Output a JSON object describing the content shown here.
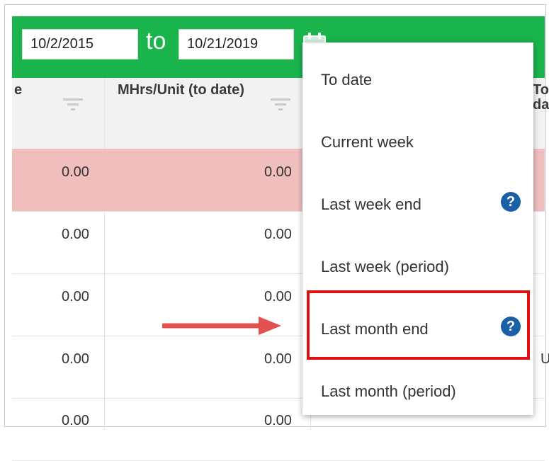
{
  "filter": {
    "start_date": "10/2/2015",
    "to_label": "to",
    "end_date": "10/21/2019"
  },
  "columns": [
    {
      "label": "e"
    },
    {
      "label": "MHrs/Unit (to date)"
    },
    {
      "label": "To da"
    }
  ],
  "rows": [
    {
      "c1": "0.00",
      "c2": "0.00",
      "highlighted": true
    },
    {
      "c1": "0.00",
      "c2": "0.00"
    },
    {
      "c1": "0.00",
      "c2": "0.00"
    },
    {
      "c1": "0.00",
      "c2": "0.00",
      "c3": "U"
    },
    {
      "c1": "0.00",
      "c2": "0.00"
    }
  ],
  "menu": {
    "items": [
      {
        "label": "To date"
      },
      {
        "label": "Current week"
      },
      {
        "label": "Last week end",
        "help_icon": "question-circle-icon"
      },
      {
        "label": "Last week (period)"
      },
      {
        "label": "Last month end",
        "help_icon": "question-circle-icon",
        "highlighted": true
      },
      {
        "label": "Last month (period)"
      }
    ],
    "help_glyph": "?"
  },
  "colors": {
    "header_green": "#1ab44d",
    "highlight_row": "#f1bebe",
    "annotation_red": "#e01010",
    "help_blue": "#1b5fa8"
  }
}
